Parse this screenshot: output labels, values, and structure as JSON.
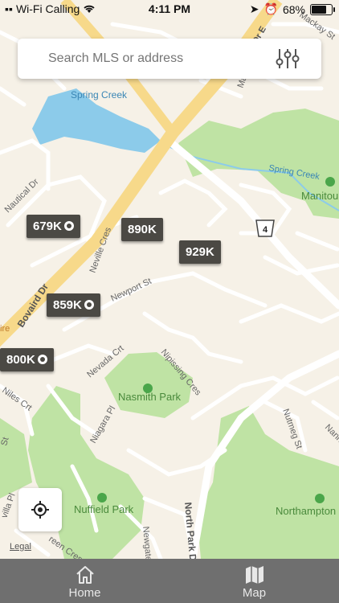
{
  "status_bar": {
    "carrier": "Wi-Fi Calling",
    "time": "4:11 PM",
    "battery": "68%"
  },
  "search": {
    "placeholder": "Search MLS or address"
  },
  "map": {
    "labels": {
      "spring_creek_pond": "Spring Creek",
      "spring_creek_river": "Spring Creek",
      "manitou": "Manitou",
      "nautical_dr": "Nautical Dr",
      "neville_cres": "Neville Cres",
      "newport_st": "Newport St",
      "bovaird_dr": "Bovaird Dr",
      "nevada_crt": "Nevada Crt",
      "nipissing_cres": "Nipissing Cres",
      "niles_crt": "Niles Crt",
      "niagara_pl": "Niagara Pl",
      "nutmeg_st": "Nutmeg St",
      "north_park_dr": "North Park Dr",
      "nuffield_park": "Nuffield Park",
      "nasmith_park": "Nasmith Park",
      "northampton": "Northampton",
      "route_4": "4",
      "mackay_st": "Mackay St",
      "newgate": "Newgate",
      "greengrove_cres": "reen Cres",
      "sevilla_pl": "villa Pl",
      "ire": "ire",
      "n_st": "St",
      "dr_e": "Dr E",
      "manit": "Manit",
      "nann": "Nann"
    },
    "price_tags": [
      {
        "label": "679K",
        "badge": true
      },
      {
        "label": "890K",
        "badge": false
      },
      {
        "label": "929K",
        "badge": false
      },
      {
        "label": "859K",
        "badge": true
      },
      {
        "label": "800K",
        "badge": true
      }
    ],
    "legal": "Legal"
  },
  "tabs": [
    {
      "label": "Home",
      "icon": "home-icon"
    },
    {
      "label": "Map",
      "icon": "map-icon"
    }
  ],
  "colors": {
    "land": "#f6f1e7",
    "park": "#bfe3a4",
    "water": "#8ccbea",
    "highway": "#f7d98a",
    "tag": "#4b4944",
    "tabbar": "#6f6f6f"
  }
}
